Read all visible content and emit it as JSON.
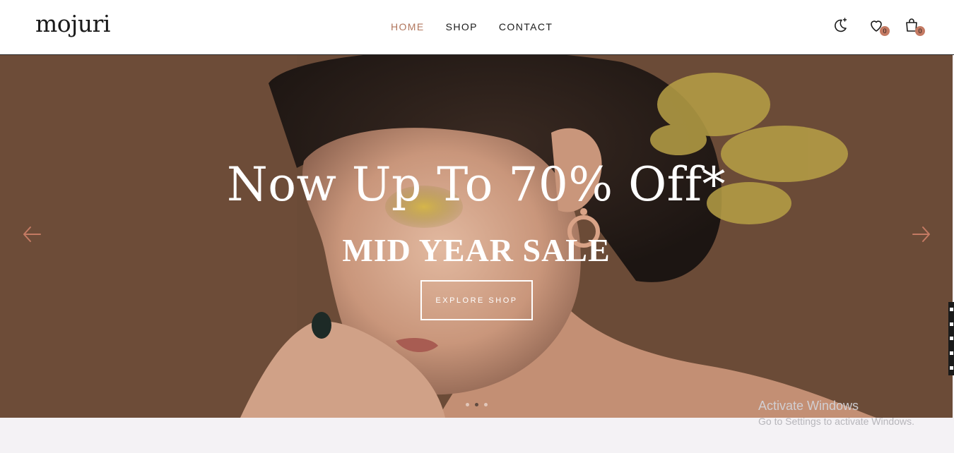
{
  "brand": {
    "logo_text": "mojuri"
  },
  "nav": {
    "items": [
      {
        "label": "HOME",
        "active": true
      },
      {
        "label": "SHOP",
        "active": false
      },
      {
        "label": "CONTACT",
        "active": false
      }
    ]
  },
  "header_icons": {
    "theme_icon": "moon-stars-icon",
    "wishlist": {
      "icon": "heart-icon",
      "count": "0"
    },
    "cart": {
      "icon": "shopping-bag-icon",
      "count": "0"
    }
  },
  "hero": {
    "title": "Now Up To 70% Off*",
    "subtitle": "MID YEAR SALE",
    "button_label": "EXPLORE SHOP",
    "prev_icon": "arrow-left-icon",
    "next_icon": "arrow-right-icon",
    "slide_count": 3,
    "active_slide": 2
  },
  "watermark": {
    "title": "Activate Windows",
    "subtitle": "Go to Settings to activate Windows."
  },
  "colors": {
    "accent": "#b0755c",
    "badge": "#c47a63",
    "text": "#1a1a1a",
    "hero_bg": "#6a4a35"
  }
}
